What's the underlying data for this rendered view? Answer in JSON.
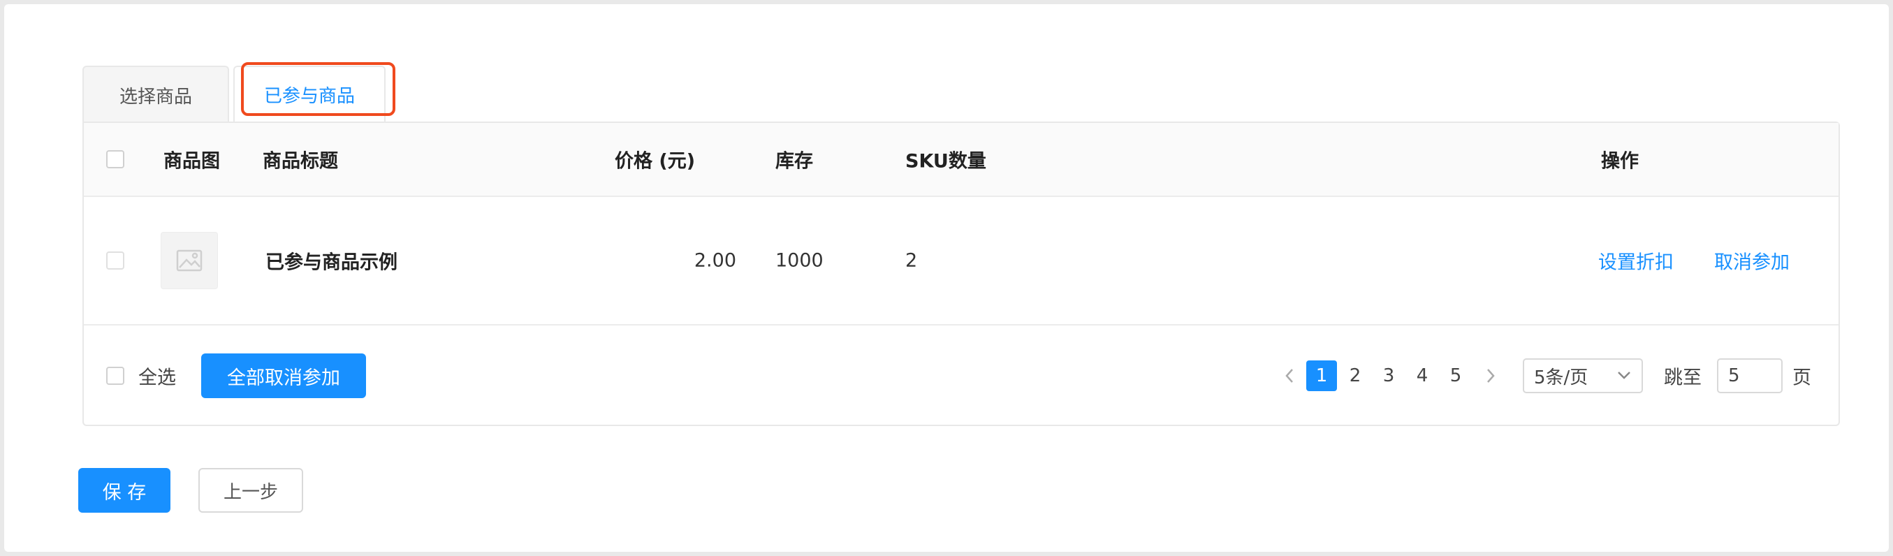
{
  "tabs": {
    "select_goods": "选择商品",
    "joined_goods": "已参与商品"
  },
  "table": {
    "headers": {
      "image": "商品图",
      "title": "商品标题",
      "price": "价格 (元)",
      "stock": "库存",
      "sku": "SKU数量",
      "actions": "操作"
    },
    "rows": [
      {
        "title": "已参与商品示例",
        "price": "2.00",
        "stock": "1000",
        "sku": "2",
        "action_discount": "设置折扣",
        "action_cancel": "取消参加"
      }
    ]
  },
  "footer": {
    "select_all": "全选",
    "cancel_all_button": "全部取消参加",
    "pagination": {
      "pages": [
        "1",
        "2",
        "3",
        "4",
        "5"
      ],
      "current": "1",
      "page_size": "5条/页",
      "jump_label": "跳至",
      "jump_value": "5",
      "page_suffix": "页"
    }
  },
  "actions": {
    "save": "保 存",
    "prev": "上一步"
  },
  "colors": {
    "primary": "#1890ff",
    "highlight": "#f04a1e"
  }
}
